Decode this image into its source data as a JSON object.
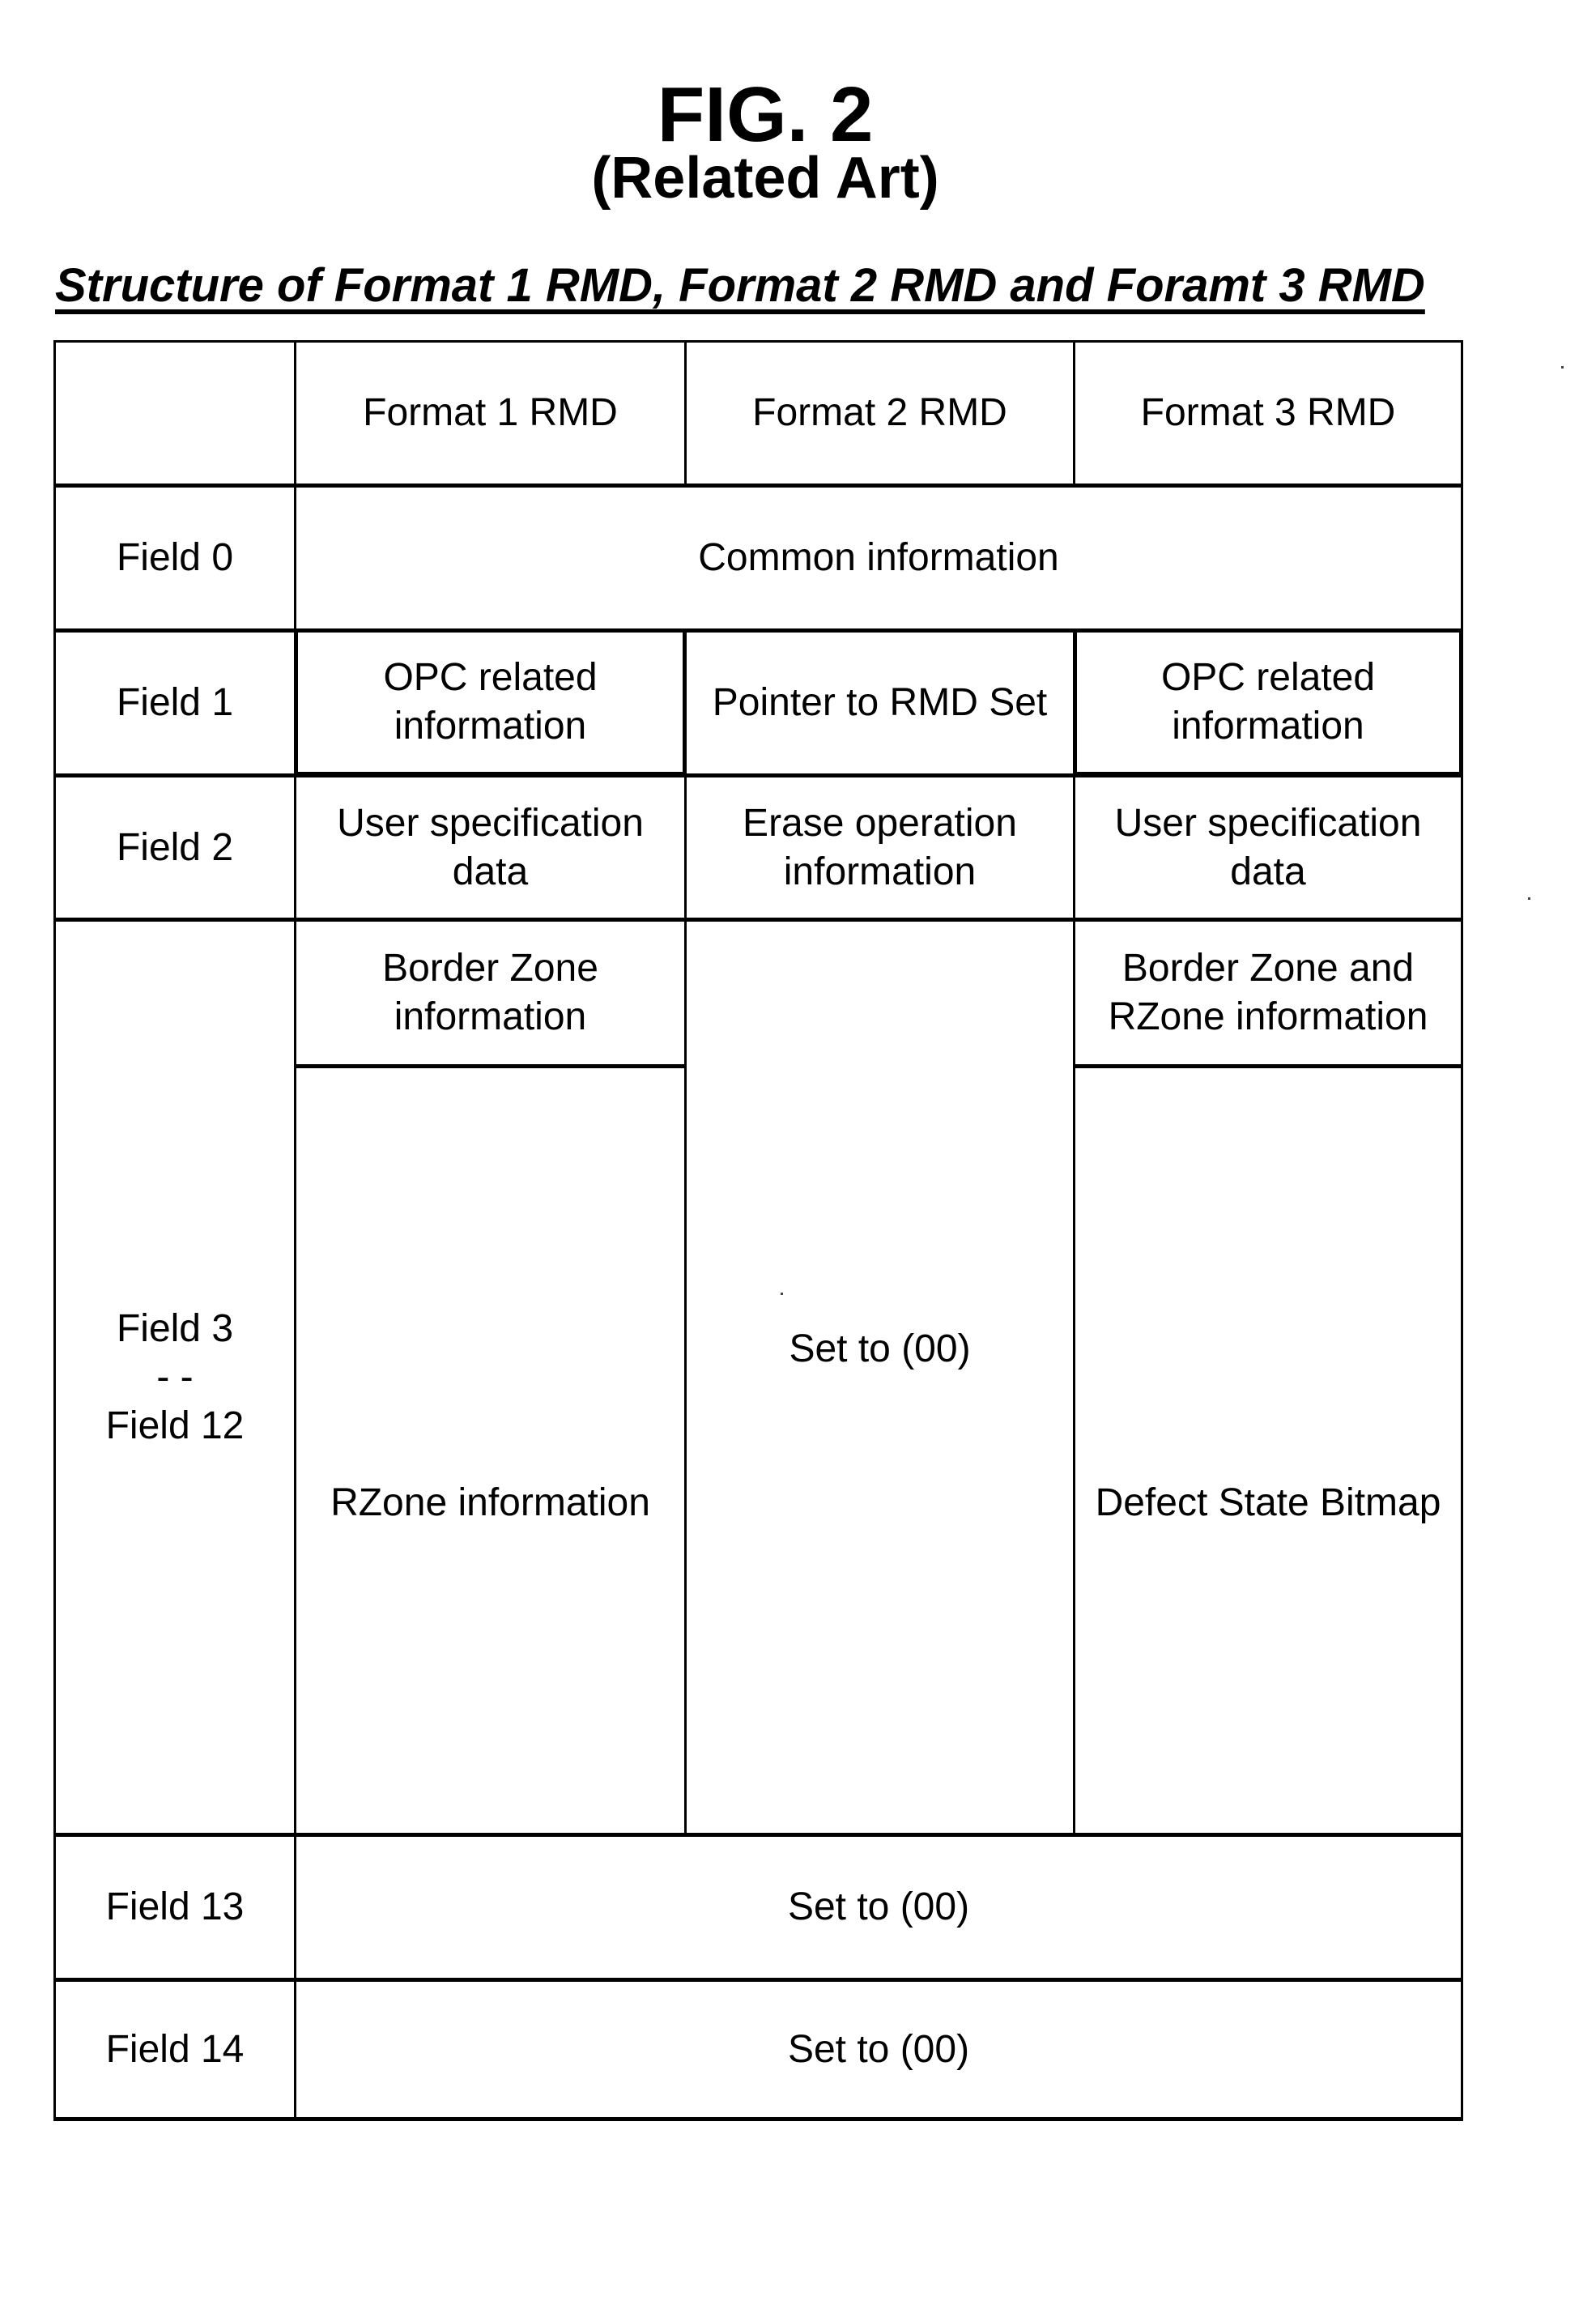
{
  "figure": {
    "title": "FIG. 2",
    "subtitle": "(Related Art)",
    "caption": "Structure of Format 1 RMD, Format 2 RMD and Foramt 3 RMD"
  },
  "table": {
    "header": {
      "corner": "",
      "columns": [
        "Format 1 RMD",
        "Format 2 RMD",
        "Format 3 RMD"
      ]
    },
    "rows": {
      "field0": {
        "label": "Field 0",
        "merged": "Common information"
      },
      "field1": {
        "label": "Field 1",
        "format1": "OPC related information",
        "format2": "Pointer to RMD Set",
        "format3": "OPC related information"
      },
      "field2": {
        "label": "Field 2",
        "format1": "User specification data",
        "format2": "Erase operation information",
        "format3": "User specification data"
      },
      "field3_12": {
        "label_line1": "Field 3",
        "label_line2": "- -",
        "label_line3": "Field 12",
        "format1_top": "Border Zone information",
        "format1_bottom": "RZone information",
        "format2": "Set to (00)",
        "format3_top": "Border Zone and RZone information",
        "format3_bottom": "Defect State Bitmap"
      },
      "field13": {
        "label": "Field 13",
        "merged": "Set to (00)"
      },
      "field14": {
        "label": "Field 14",
        "merged": "Set to (00)"
      }
    }
  }
}
